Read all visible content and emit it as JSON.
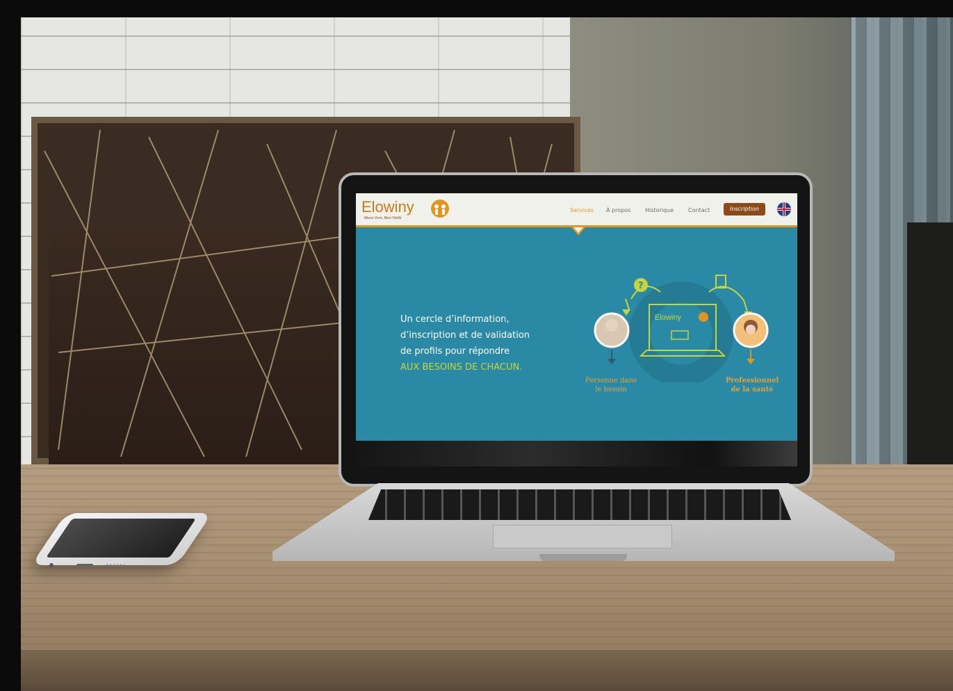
{
  "website": {
    "logo_text": "Elowiny",
    "logo_tagline": "Mieux Vivre, Bien Vieillir",
    "nav": [
      "Services",
      "À propos",
      "Historique",
      "Contact"
    ],
    "cta_label": "Inscription",
    "hero_line1": "Un cercle d’information,",
    "hero_line2": "d’inscription et de validation",
    "hero_line3": "de profils pour répondre",
    "hero_highlight": "AUX BESOINS DE CHACUN.",
    "left_label_1": "Personne dans",
    "left_label_2": "le besoin",
    "right_label_1": "Professionnel",
    "right_label_2": "de la santé",
    "screen_logo": "Elowiny",
    "accent_color": "#e3961f",
    "highlight_color": "#c5d53a",
    "background_color": "#2a8aa6",
    "cta_color": "#8a4a1a"
  },
  "scene": {
    "objects": [
      "laptop",
      "smartphone",
      "wooden-table",
      "fireplace-screen",
      "brick-wall",
      "curtain"
    ]
  }
}
